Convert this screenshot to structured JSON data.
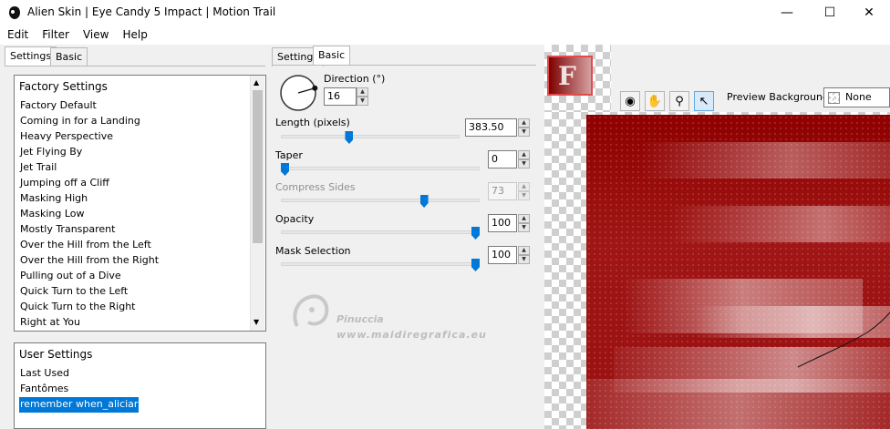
{
  "window": {
    "title": "Alien Skin | Eye Candy 5 Impact | Motion Trail",
    "minimize_glyph": "—",
    "maximize_glyph": "☐",
    "close_glyph": "✕"
  },
  "menu": [
    "Edit",
    "Filter",
    "View",
    "Help"
  ],
  "left_tabs": [
    {
      "label": "Settings",
      "active": true
    },
    {
      "label": "Basic",
      "active": false
    }
  ],
  "factory": {
    "header": "Factory Settings",
    "items": [
      "Factory Default",
      "Coming in for a Landing",
      "Heavy Perspective",
      "Jet Flying By",
      "Jet Trail",
      "Jumping off a Cliff",
      "Masking High",
      "Masking Low",
      "Mostly Transparent",
      "Over the Hill from the Left",
      "Over the Hill from the Right",
      "Pulling out of a Dive",
      "Quick Turn to the Left",
      "Quick Turn to the Right",
      "Right at You"
    ]
  },
  "user": {
    "header": "User Settings",
    "items": [
      "Last Used",
      "Fantômes",
      "remember when_aliciar"
    ],
    "selected_index": 2
  },
  "middle_tabs": [
    {
      "label": "Settings",
      "active": false
    },
    {
      "label": "Basic",
      "active": true
    }
  ],
  "controls": {
    "direction": {
      "label": "Direction (°)",
      "value": "16",
      "angle_degrees": 16
    },
    "length": {
      "label": "Length (pixels)",
      "value": "383.50",
      "fraction": 0.38
    },
    "taper": {
      "label": "Taper",
      "value": "0",
      "fraction": 0.0
    },
    "compress": {
      "label": "Compress Sides",
      "value": "73",
      "fraction": 0.73,
      "disabled": true
    },
    "opacity": {
      "label": "Opacity",
      "value": "100",
      "fraction": 1.0
    },
    "mask": {
      "label": "Mask Selection",
      "value": "100",
      "fraction": 1.0
    }
  },
  "watermark": {
    "name": "Pinuccia",
    "url": "www.maidiregrafica.eu"
  },
  "preview": {
    "background_label": "Preview Background:",
    "background_value": "None",
    "tools": [
      "eye-toggle-icon",
      "hand-icon",
      "zoom-icon",
      "pointer-icon"
    ],
    "accent_color": "#960000"
  }
}
